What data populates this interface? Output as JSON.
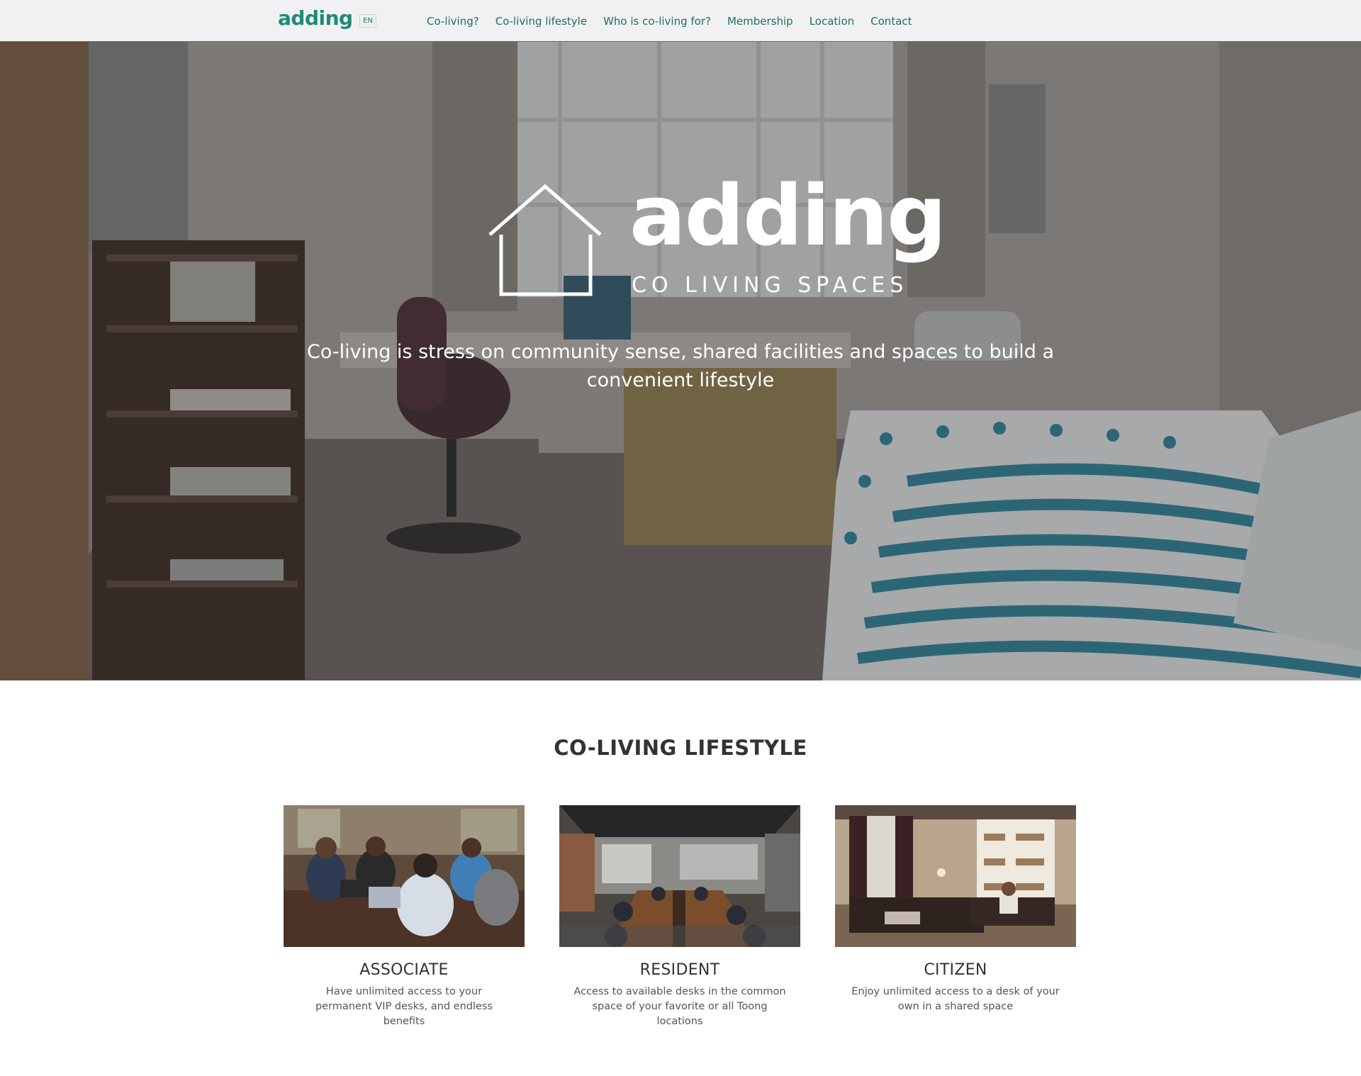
{
  "brand": {
    "logo_text": "adding",
    "accent_color": "#1f8a76"
  },
  "header": {
    "language": "EN",
    "nav": [
      {
        "label": "Co-living?"
      },
      {
        "label": "Co-living lifestyle"
      },
      {
        "label": "Who is co-living for?"
      },
      {
        "label": "Membership"
      },
      {
        "label": "Location"
      },
      {
        "label": "Contact"
      }
    ]
  },
  "hero": {
    "brand": "adding",
    "subtitle": "CO LIVING SPACES",
    "tagline": "Co-living is stress on community sense, shared facilities and spaces to build a convenient lifestyle",
    "background": "bedroom-photo"
  },
  "lifestyle": {
    "title": "CO-LIVING LIFESTYLE",
    "cards": [
      {
        "title": "ASSOCIATE",
        "description": "Have unlimited access to your permanent VIP desks, and endless benefits",
        "image": "people-working-at-table-photo"
      },
      {
        "title": "RESIDENT",
        "description": "Access to available desks in the common space of your favorite or all Toong locations",
        "image": "common-coworking-space-photo"
      },
      {
        "title": "CITIZEN",
        "description": "Enjoy unlimited access to a desk of your own in a shared space",
        "image": "shared-lounge-photo"
      }
    ]
  }
}
